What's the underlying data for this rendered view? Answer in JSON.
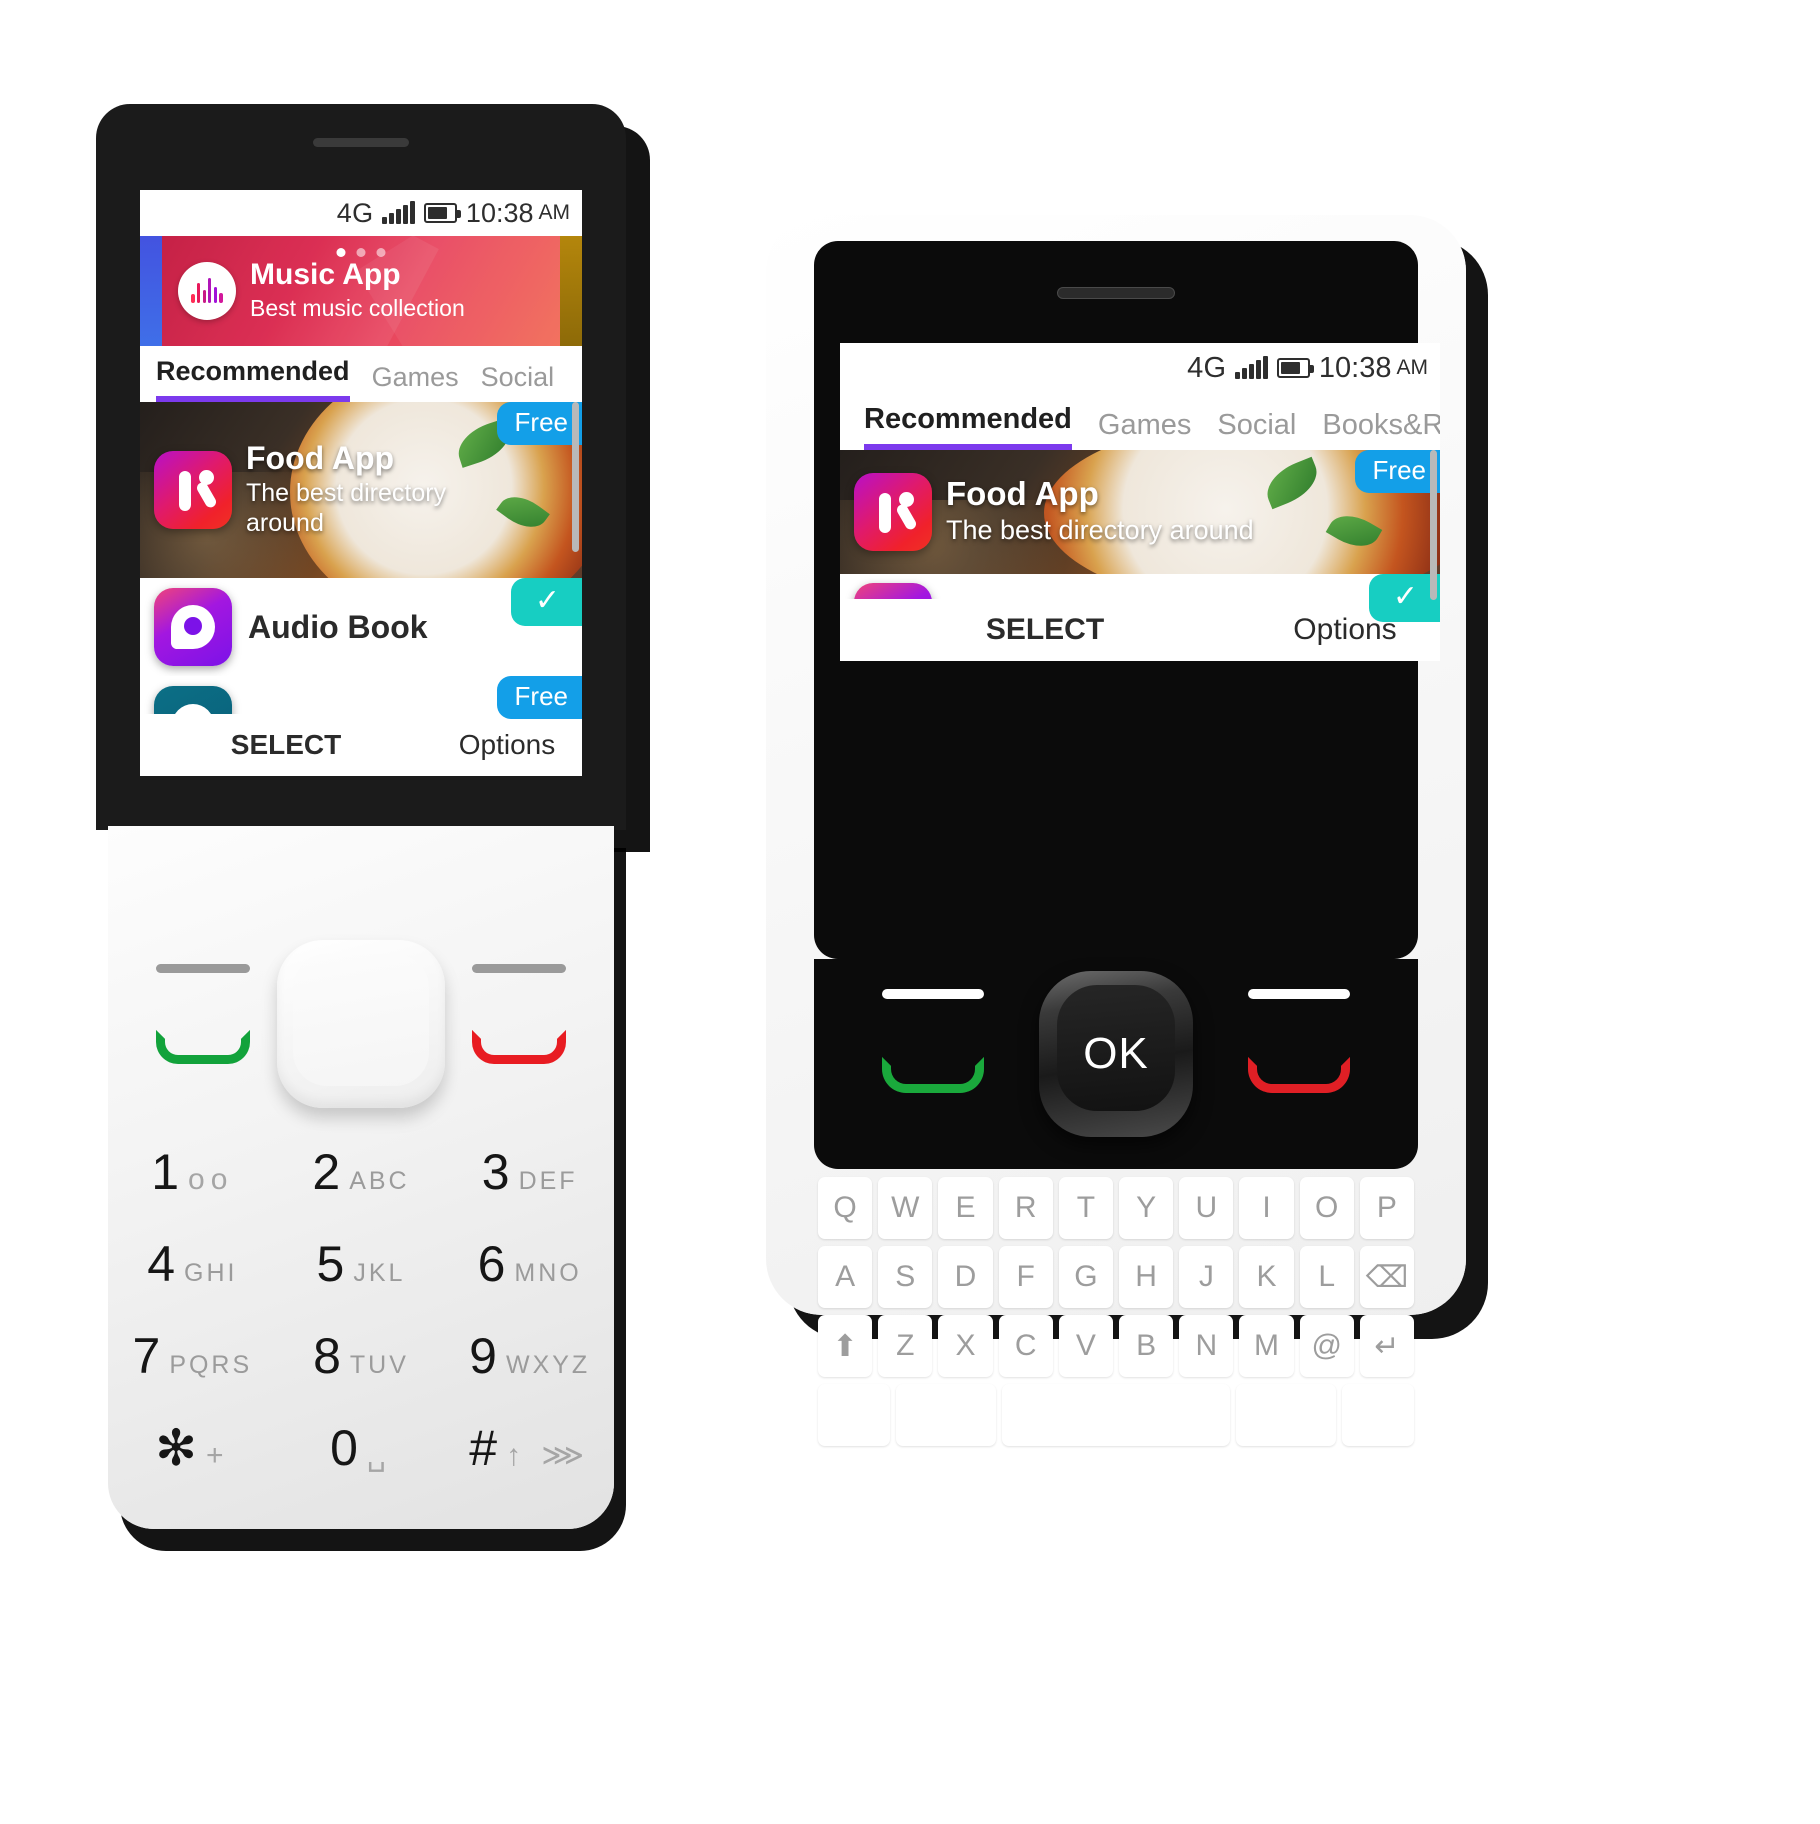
{
  "status_bar": {
    "network": "4G",
    "time": "10:38",
    "meridiem": "AM",
    "signal_icon": "signal-bars-icon",
    "battery_icon": "battery-icon"
  },
  "banner": {
    "title": "Music App",
    "subtitle": "Best music collection",
    "icon": "music-wave-icon",
    "dots": [
      "active",
      "inactive",
      "inactive"
    ]
  },
  "tabs_left": [
    {
      "label": "Recommended",
      "active": true
    },
    {
      "label": "Games",
      "active": false
    },
    {
      "label": "Social",
      "active": false
    }
  ],
  "tabs_right": [
    {
      "label": "Recommended",
      "active": true
    },
    {
      "label": "Games",
      "active": false
    },
    {
      "label": "Social",
      "active": false
    },
    {
      "label": "Books&Refe",
      "active": false
    }
  ],
  "apps": {
    "food": {
      "title": "Food App",
      "subtitle_left": "The best directory around",
      "subtitle_right": "The best directory around",
      "badge": "Free",
      "icon": "food-app-k-icon"
    },
    "audio": {
      "title": "Audio Book",
      "badge": "check-icon",
      "icon": "audio-book-a-icon"
    },
    "third": {
      "badge": "Free",
      "icon": "app-icon-partial"
    }
  },
  "softkeys": {
    "select": "SELECT",
    "options": "Options",
    "ok": "OK"
  },
  "keypad": [
    {
      "digit": "1",
      "letters": "voicemail-icon",
      "symbol": true
    },
    {
      "digit": "2",
      "letters": "ABC"
    },
    {
      "digit": "3",
      "letters": "DEF"
    },
    {
      "digit": "4",
      "letters": "GHI"
    },
    {
      "digit": "5",
      "letters": "JKL"
    },
    {
      "digit": "6",
      "letters": "MNO"
    },
    {
      "digit": "7",
      "letters": "PQRS"
    },
    {
      "digit": "8",
      "letters": "TUV"
    },
    {
      "digit": "9",
      "letters": "WXYZ"
    },
    {
      "digit": "✻",
      "letters": "+"
    },
    {
      "digit": "0",
      "letters": "␣"
    },
    {
      "digit": "#",
      "letters": "↑ ⋙"
    }
  ],
  "qwerty": {
    "row1": [
      "Q",
      "W",
      "E",
      "R",
      "T",
      "Y",
      "U",
      "I",
      "O",
      "P"
    ],
    "row2": [
      "A",
      "S",
      "D",
      "F",
      "G",
      "H",
      "J",
      "K",
      "L",
      "⌫"
    ],
    "row3": [
      "⬆",
      "Z",
      "X",
      "C",
      "V",
      "B",
      "N",
      "M",
      "@",
      "↵"
    ],
    "row4": [
      "",
      "",
      "",
      "",
      ""
    ]
  },
  "colors": {
    "accent_tab": "#7c3aed",
    "badge_free": "#139fe8",
    "badge_check": "#17cec2",
    "call_green": "#12a23b",
    "end_red": "#e81c22"
  }
}
